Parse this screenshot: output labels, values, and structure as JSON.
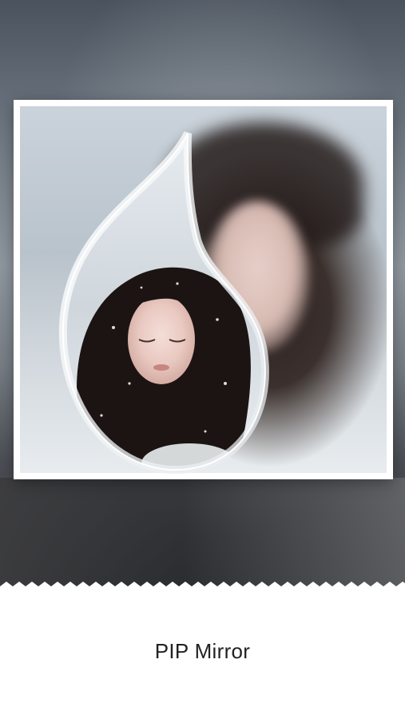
{
  "screenshot": {
    "feature_title": "PIP Mirror",
    "frame_shape": "water-drop",
    "colors": {
      "caption_text": "#222222",
      "background_bottom": "#ffffff",
      "frame_border": "#ffffff"
    }
  }
}
